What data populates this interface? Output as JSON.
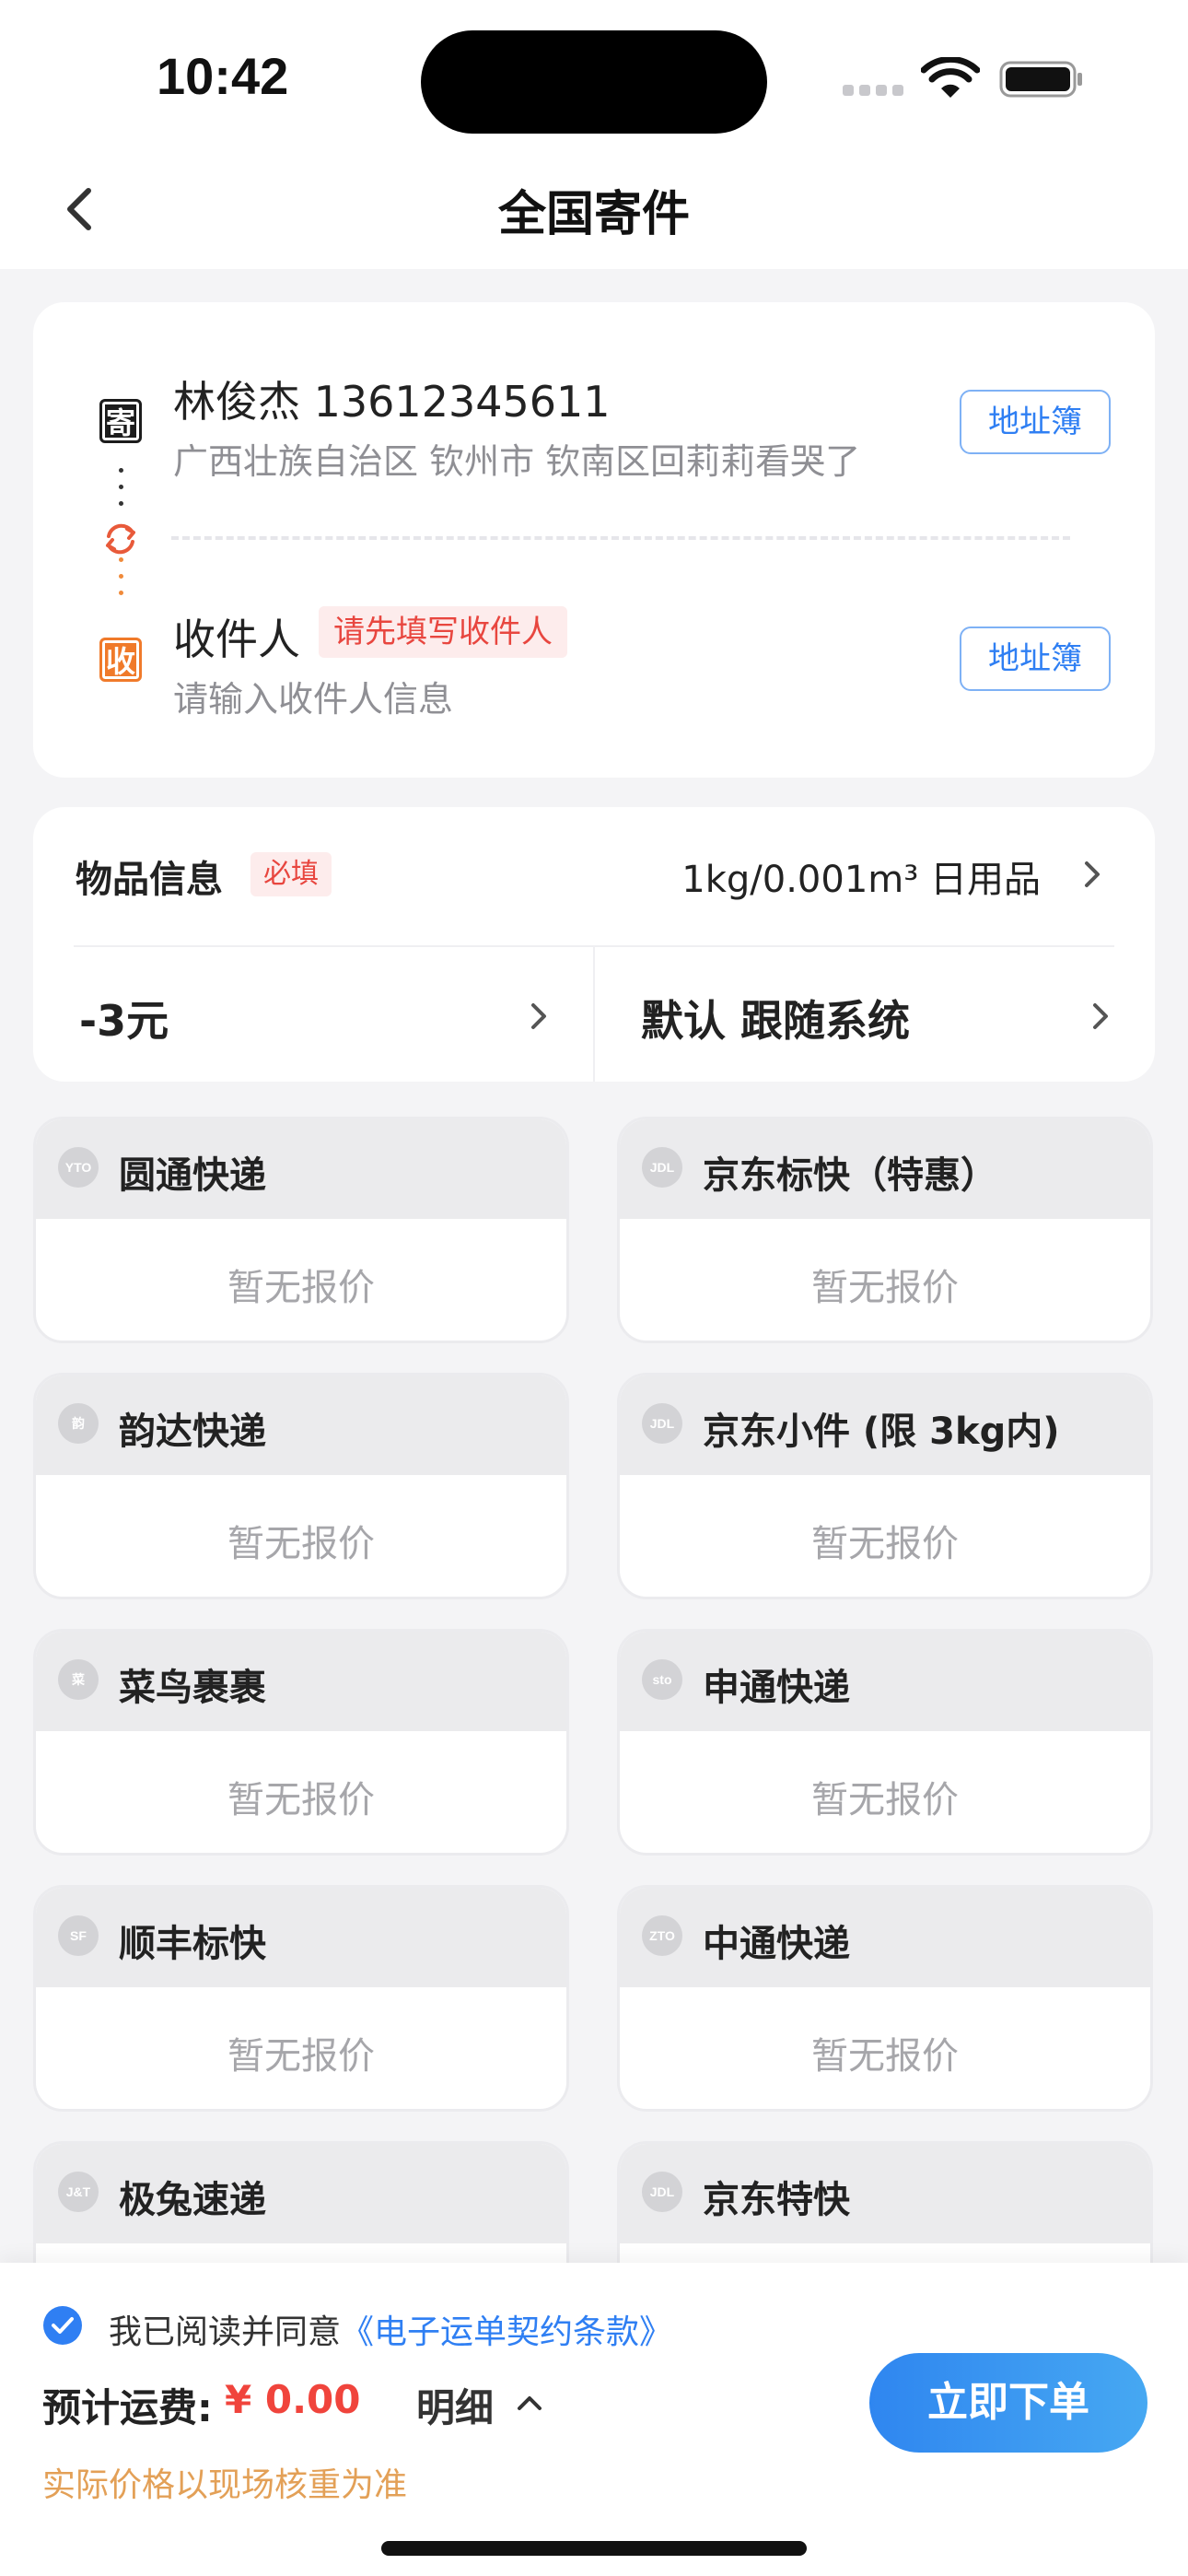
{
  "status_bar": {
    "time": "10:42"
  },
  "nav": {
    "title": "全国寄件"
  },
  "address": {
    "sender_badge": "寄",
    "sender_name": "林俊杰 13612345611",
    "sender_address": "广西壮族自治区 钦州市 钦南区回莉莉看哭了",
    "receiver_badge": "收",
    "receiver_label": "收件人",
    "receiver_warning": "请先填写收件人",
    "receiver_placeholder": "请输入收件人信息",
    "address_book_label": "地址簿"
  },
  "item_info": {
    "label": "物品信息",
    "required_tag": "必填",
    "value": "1kg/0.001m³ 日用品",
    "discount": "-3元",
    "settings": "默认 跟随系统"
  },
  "couriers": [
    {
      "name": "圆通快递",
      "logo": "YTO",
      "price": "暂无报价"
    },
    {
      "name": "京东标快（特惠）",
      "logo": "JDL",
      "price": "暂无报价"
    },
    {
      "name": "韵达快递",
      "logo": "韵",
      "price": "暂无报价"
    },
    {
      "name": "京东小件 (限 3kg内)",
      "logo": "JDL",
      "price": "暂无报价"
    },
    {
      "name": "菜鸟裹裹",
      "logo": "菜",
      "price": "暂无报价"
    },
    {
      "name": "申通快递",
      "logo": "sto",
      "price": "暂无报价"
    },
    {
      "name": "顺丰标快",
      "logo": "SF",
      "price": "暂无报价"
    },
    {
      "name": "中通快递",
      "logo": "ZTO",
      "price": "暂无报价"
    },
    {
      "name": "极兔速递",
      "logo": "J&T",
      "price": ""
    },
    {
      "name": "京东特快",
      "logo": "JDL",
      "price": ""
    }
  ],
  "bottom": {
    "agree_prefix": "我已阅读并同意",
    "agree_link": "《电子运单契约条款》",
    "freight_label": "预计运费:",
    "freight_value": "¥ 0.00",
    "detail_label": "明细",
    "note": "实际价格以现场核重为准",
    "order_button": "立即下单"
  },
  "colors": {
    "accent": "#2f7ff3",
    "warning": "#e8463f",
    "note": "#e3a057",
    "sender_badge": "#1c1c1c",
    "receiver_badge": "#f07a2a"
  }
}
